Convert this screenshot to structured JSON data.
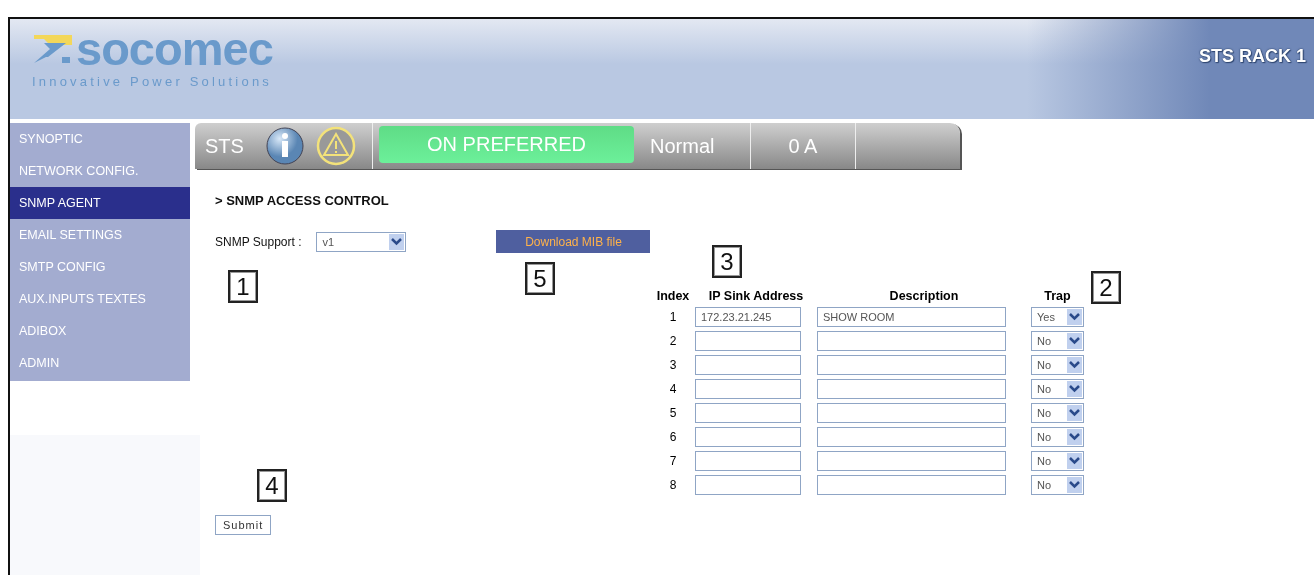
{
  "header": {
    "brand": "socomec",
    "tagline": "Innovative Power Solutions",
    "device": "STS RACK 1"
  },
  "sidebar": {
    "items": [
      {
        "label": "SYNOPTIC",
        "selected": false
      },
      {
        "label": "NETWORK CONFIG.",
        "selected": false
      },
      {
        "label": "SNMP AGENT",
        "selected": true
      },
      {
        "label": "EMAIL SETTINGS",
        "selected": false
      },
      {
        "label": "SMTP CONFIG",
        "selected": false
      },
      {
        "label": "AUX.INPUTS TEXTES",
        "selected": false
      },
      {
        "label": "ADIBOX",
        "selected": false
      },
      {
        "label": "ADMIN",
        "selected": false
      }
    ]
  },
  "status_bar": {
    "device": "STS",
    "state": "ON PREFERRED",
    "mode": "Normal",
    "current": "0 A"
  },
  "page": {
    "title": "> SNMP ACCESS CONTROL",
    "support_label": "SNMP Support :",
    "support_value": "v1",
    "download_button": "Download MIB file",
    "submit_button": "Submit"
  },
  "table": {
    "columns": [
      "Index",
      "IP Sink Address",
      "Description",
      "Trap"
    ],
    "rows": [
      {
        "index": "1",
        "ip": "172.23.21.245",
        "description": "SHOW ROOM",
        "trap": "Yes"
      },
      {
        "index": "2",
        "trap": "No"
      },
      {
        "index": "3",
        "trap": "No"
      },
      {
        "index": "4",
        "trap": "No"
      },
      {
        "index": "5",
        "trap": "No"
      },
      {
        "index": "6",
        "trap": "No"
      },
      {
        "index": "7",
        "trap": "No"
      },
      {
        "index": "8",
        "trap": "No"
      }
    ]
  },
  "callouts": [
    {
      "label": "1"
    },
    {
      "label": "5"
    },
    {
      "label": "3"
    },
    {
      "label": "2"
    },
    {
      "label": "4"
    }
  ]
}
